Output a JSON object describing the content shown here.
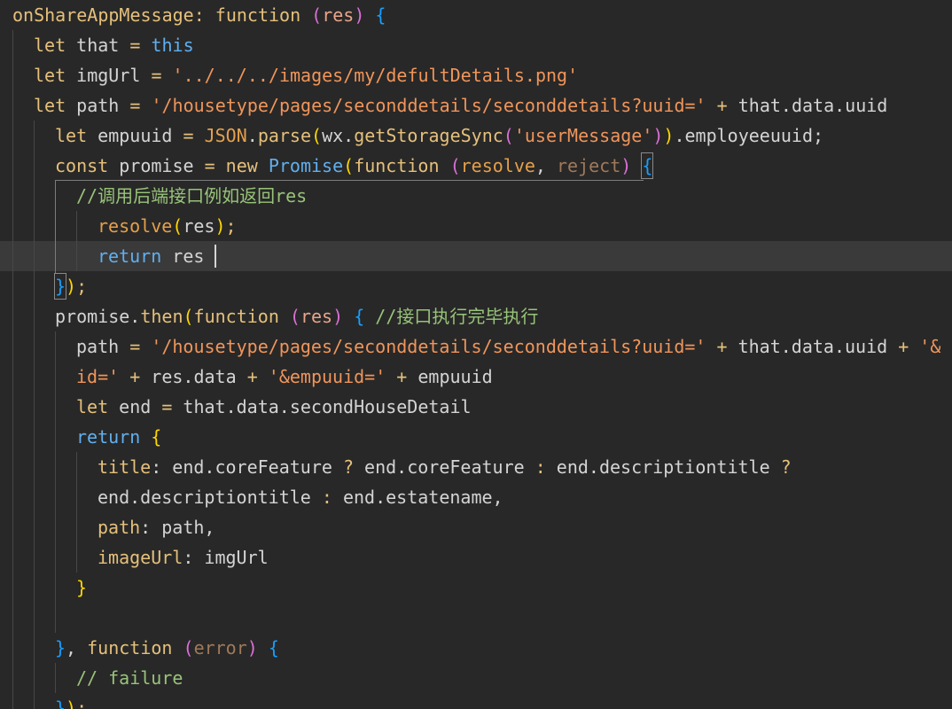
{
  "code": {
    "lines": [
      {
        "tokens": [
          {
            "text": "onShareAppMessage: function ",
            "color": "#e5c07b"
          },
          {
            "text": "(",
            "color": "#da70d6"
          },
          {
            "text": "res",
            "color": "#e8a58b"
          },
          {
            "text": ") ",
            "color": "#da70d6"
          },
          {
            "text": "{",
            "color": "#179fff"
          }
        ]
      },
      {
        "tokens": [
          {
            "text": "let",
            "color": "#e5c07b"
          },
          {
            "text": " that ",
            "color": "#d4d4d4"
          },
          {
            "text": "= ",
            "color": "#e5c07b"
          },
          {
            "text": "this",
            "color": "#61afef"
          }
        ]
      },
      {
        "tokens": [
          {
            "text": "let",
            "color": "#e5c07b"
          },
          {
            "text": " imgUrl ",
            "color": "#d4d4d4"
          },
          {
            "text": "= ",
            "color": "#e5c07b"
          },
          {
            "text": "'../../../images/my/defultDetails.png'",
            "color": "#f0955a"
          }
        ]
      },
      {
        "tokens": [
          {
            "text": "let",
            "color": "#e5c07b"
          },
          {
            "text": " path ",
            "color": "#d4d4d4"
          },
          {
            "text": "= ",
            "color": "#e5c07b"
          },
          {
            "text": "'/housetype/pages/seconddetails/seconddetails?uuid=' ",
            "color": "#f0955a"
          },
          {
            "text": "+",
            "color": "#e5c07b"
          },
          {
            "text": " that.data.uuid",
            "color": "#d4d4d4"
          }
        ]
      },
      {
        "tokens": [
          {
            "text": "let",
            "color": "#e5c07b"
          },
          {
            "text": " empuuid ",
            "color": "#d4d4d4"
          },
          {
            "text": "= ",
            "color": "#e5c07b"
          },
          {
            "text": "JSON",
            "color": "#e5a04b"
          },
          {
            "text": ".",
            "color": "#d4d4d4"
          },
          {
            "text": "parse",
            "color": "#e5c07b"
          },
          {
            "text": "(",
            "color": "#ffd700"
          },
          {
            "text": "wx.",
            "color": "#d4d4d4"
          },
          {
            "text": "getStorageSync",
            "color": "#e5c07b"
          },
          {
            "text": "(",
            "color": "#da70d6"
          },
          {
            "text": "'userMessage'",
            "color": "#f0955a"
          },
          {
            "text": ")",
            "color": "#da70d6"
          },
          {
            "text": ")",
            "color": "#ffd700"
          },
          {
            "text": ".employeeuuid;",
            "color": "#d4d4d4"
          }
        ]
      },
      {
        "tokens": [
          {
            "text": "const",
            "color": "#e5c07b"
          },
          {
            "text": " promise ",
            "color": "#d4d4d4"
          },
          {
            "text": "= new ",
            "color": "#e5c07b"
          },
          {
            "text": "Promise",
            "color": "#61afef"
          },
          {
            "text": "(",
            "color": "#ffd700"
          },
          {
            "text": "function ",
            "color": "#e5c07b"
          },
          {
            "text": "(",
            "color": "#da70d6"
          },
          {
            "text": "resolve",
            "color": "#e5a04b"
          },
          {
            "text": ", ",
            "color": "#d4d4d4"
          },
          {
            "text": "reject",
            "color": "#a0795a"
          },
          {
            "text": ") ",
            "color": "#da70d6"
          },
          {
            "text": "{",
            "color": "#179fff"
          }
        ]
      },
      {
        "tokens": [
          {
            "text": "//调用后端接口例如返回res",
            "color": "#98c379"
          }
        ]
      },
      {
        "tokens": [
          {
            "text": "resolve",
            "color": "#e5a04b"
          },
          {
            "text": "(",
            "color": "#ffd700"
          },
          {
            "text": "res",
            "color": "#d4d4d4"
          },
          {
            "text": ")",
            "color": "#ffd700"
          },
          {
            "text": ";",
            "color": "#e5c07b"
          }
        ]
      },
      {
        "tokens": [
          {
            "text": "return",
            "color": "#61afef"
          },
          {
            "text": " res ",
            "color": "#d4d4d4"
          }
        ]
      },
      {
        "tokens": [
          {
            "text": "}",
            "color": "#179fff"
          },
          {
            "text": ")",
            "color": "#ffd700"
          },
          {
            "text": ";",
            "color": "#e5c07b"
          }
        ]
      },
      {
        "tokens": [
          {
            "text": "promise.",
            "color": "#d4d4d4"
          },
          {
            "text": "then",
            "color": "#e5c07b"
          },
          {
            "text": "(",
            "color": "#ffd700"
          },
          {
            "text": "function ",
            "color": "#e5c07b"
          },
          {
            "text": "(",
            "color": "#da70d6"
          },
          {
            "text": "res",
            "color": "#e8a58b"
          },
          {
            "text": ") ",
            "color": "#da70d6"
          },
          {
            "text": "{ ",
            "color": "#179fff"
          },
          {
            "text": "//接口执行完毕执行",
            "color": "#98c379"
          }
        ]
      },
      {
        "tokens": [
          {
            "text": "path ",
            "color": "#d4d4d4"
          },
          {
            "text": "= ",
            "color": "#e5c07b"
          },
          {
            "text": "'/housetype/pages/seconddetails/seconddetails?uuid=' ",
            "color": "#f0955a"
          },
          {
            "text": "+",
            "color": "#e5c07b"
          },
          {
            "text": " that.data.uuid ",
            "color": "#d4d4d4"
          },
          {
            "text": "+ ",
            "color": "#e5c07b"
          },
          {
            "text": "'&",
            "color": "#f0955a"
          }
        ]
      },
      {
        "tokens": [
          {
            "text": "id=' ",
            "color": "#f0955a"
          },
          {
            "text": "+",
            "color": "#e5c07b"
          },
          {
            "text": " res.data ",
            "color": "#d4d4d4"
          },
          {
            "text": "+ ",
            "color": "#e5c07b"
          },
          {
            "text": "'&empuuid=' ",
            "color": "#f0955a"
          },
          {
            "text": "+",
            "color": "#e5c07b"
          },
          {
            "text": " empuuid",
            "color": "#d4d4d4"
          }
        ]
      },
      {
        "tokens": [
          {
            "text": "let",
            "color": "#e5c07b"
          },
          {
            "text": " end ",
            "color": "#d4d4d4"
          },
          {
            "text": "=",
            "color": "#e5c07b"
          },
          {
            "text": " that.data.secondHouseDetail",
            "color": "#d4d4d4"
          }
        ]
      },
      {
        "tokens": [
          {
            "text": "return ",
            "color": "#61afef"
          },
          {
            "text": "{",
            "color": "#ffd700"
          }
        ]
      },
      {
        "tokens": [
          {
            "text": "title",
            "color": "#e5c07b"
          },
          {
            "text": ": end.coreFeature ",
            "color": "#d4d4d4"
          },
          {
            "text": "?",
            "color": "#e5c07b"
          },
          {
            "text": " end.coreFeature ",
            "color": "#d4d4d4"
          },
          {
            "text": ":",
            "color": "#e5c07b"
          },
          {
            "text": " end.descriptiontitle ",
            "color": "#d4d4d4"
          },
          {
            "text": "?",
            "color": "#e5c07b"
          }
        ]
      },
      {
        "tokens": [
          {
            "text": "end.descriptiontitle ",
            "color": "#d4d4d4"
          },
          {
            "text": ":",
            "color": "#e5c07b"
          },
          {
            "text": " end.estatename,",
            "color": "#d4d4d4"
          }
        ]
      },
      {
        "tokens": [
          {
            "text": "path",
            "color": "#e5c07b"
          },
          {
            "text": ": path,",
            "color": "#d4d4d4"
          }
        ]
      },
      {
        "tokens": [
          {
            "text": "imageUrl",
            "color": "#e5c07b"
          },
          {
            "text": ": imgUrl",
            "color": "#d4d4d4"
          }
        ]
      },
      {
        "tokens": [
          {
            "text": "}",
            "color": "#ffd700"
          }
        ]
      },
      {
        "tokens": []
      },
      {
        "tokens": [
          {
            "text": "}",
            "color": "#179fff"
          },
          {
            "text": ", ",
            "color": "#d4d4d4"
          },
          {
            "text": "function ",
            "color": "#e5c07b"
          },
          {
            "text": "(",
            "color": "#da70d6"
          },
          {
            "text": "error",
            "color": "#a0795a"
          },
          {
            "text": ") ",
            "color": "#da70d6"
          },
          {
            "text": "{",
            "color": "#179fff"
          }
        ]
      },
      {
        "tokens": [
          {
            "text": "// failure",
            "color": "#98c379"
          }
        ]
      },
      {
        "tokens": [
          {
            "text": "}",
            "color": "#179fff"
          },
          {
            "text": ")",
            "color": "#ffd700"
          },
          {
            "text": ";",
            "color": "#e5c07b"
          }
        ]
      }
    ]
  }
}
